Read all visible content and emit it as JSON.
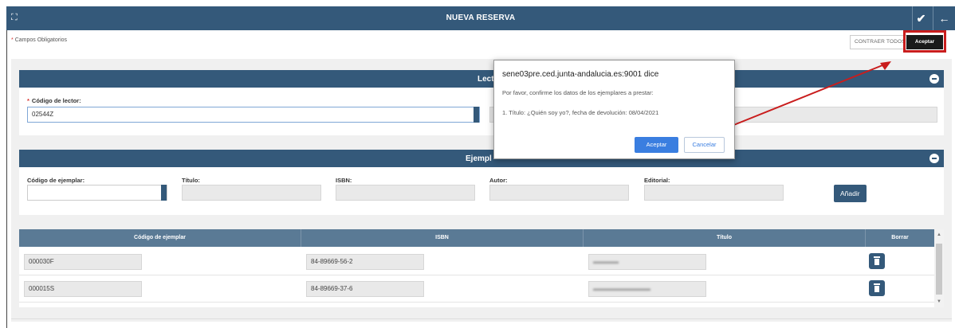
{
  "header": {
    "title": "NUEVA RESERVA"
  },
  "required_note": {
    "star": "*",
    "text": "Campos Obligatorios"
  },
  "toolbar": {
    "contraer_label": "CONTRAER TODOS",
    "tooltip_label": "Aceptar"
  },
  "lector": {
    "title": "Lector",
    "codigo_label": "Código de lector:",
    "codigo_value": "02544Z"
  },
  "ejemplar": {
    "title": "Ejempl",
    "fields": {
      "codigo": "Código de ejemplar:",
      "titulo": "Título:",
      "isbn": "ISBN:",
      "autor": "Autor:",
      "editorial": "Editorial:"
    },
    "add_label": "Añadir"
  },
  "table": {
    "headers": [
      "Código de ejemplar",
      "ISBN",
      "Título",
      "Borrar"
    ],
    "rows": [
      {
        "codigo": "000030F",
        "isbn": "84-89669-56-2"
      },
      {
        "codigo": "000015S",
        "isbn": "84-89669-37-6"
      }
    ]
  },
  "dialog": {
    "title": "sene03pre.ced.junta-andalucia.es:9001 dice",
    "message": "Por favor, confirme los datos de los ejemplares a prestar:",
    "item": "1. Título: ¿Quién soy yo?, fecha de devolución: 08/04/2021",
    "accept_label": "Aceptar",
    "cancel_label": "Cancelar"
  },
  "colors": {
    "header_bg": "#34597a",
    "table_header_bg": "#5a7a95",
    "accent_blue": "#3a7ee0",
    "annotation_red": "#c91d1d"
  }
}
